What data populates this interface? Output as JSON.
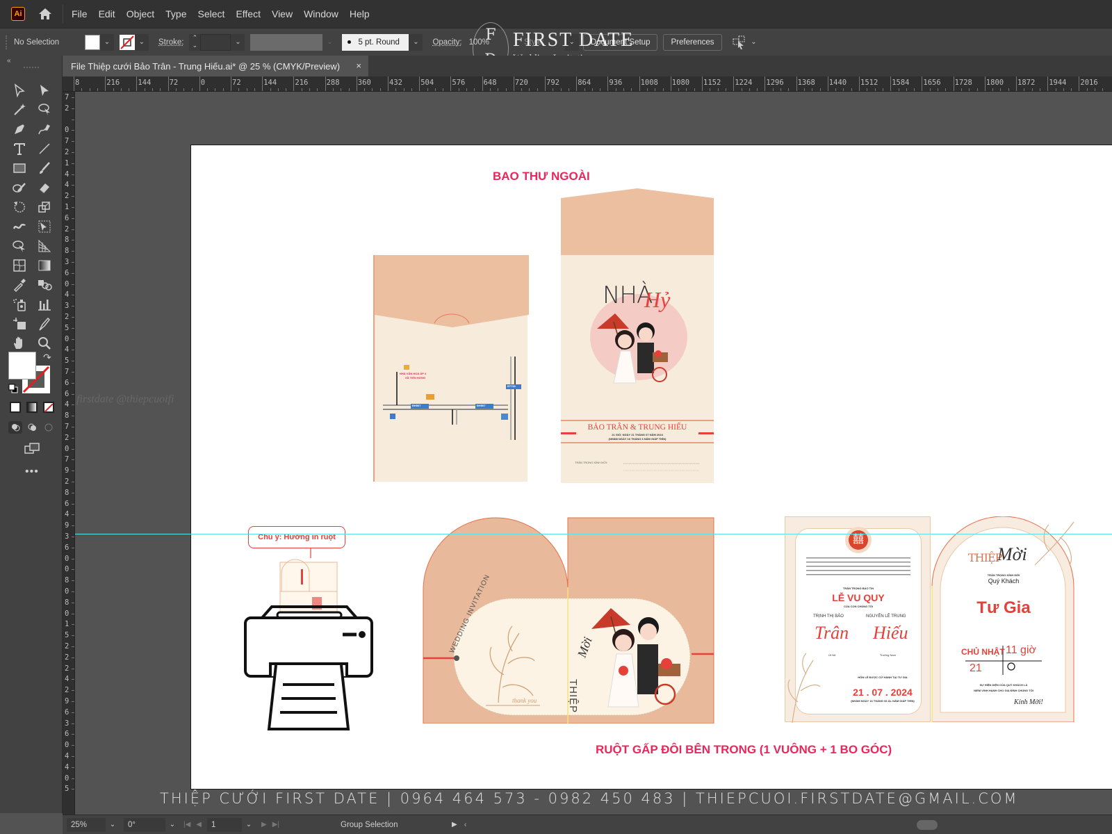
{
  "app": {
    "logo": "Ai",
    "menu": [
      "File",
      "Edit",
      "Object",
      "Type",
      "Select",
      "Effect",
      "View",
      "Window",
      "Help"
    ]
  },
  "control_bar": {
    "selection_state": "No Selection",
    "stroke_label": "Stroke:",
    "brush_label": "5 pt. Round",
    "opacity_label": "Opacity:",
    "opacity_value": "100%",
    "style_label": "Style:",
    "document_setup": "Document Setup",
    "preferences": "Preferences"
  },
  "brand": {
    "monogram_top": "F",
    "monogram_bottom": "D",
    "name": "FIRST DATE",
    "subtitle": "Wedding Invitation"
  },
  "document_tab": {
    "title": "File Thiệp cưới Bảo Trân - Trung Hiếu.ai* @ 25 % (CMYK/Preview)",
    "close": "×"
  },
  "rulers": {
    "horizontal": [
      "8",
      "216",
      "144",
      "72",
      "0",
      "72",
      "144",
      "216",
      "288",
      "360",
      "432",
      "504",
      "576",
      "648",
      "720",
      "792",
      "864",
      "936",
      "1008",
      "1080",
      "1152",
      "1224",
      "1296",
      "1368",
      "1440",
      "1512",
      "1584",
      "1656",
      "1728",
      "1800",
      "1872",
      "1944",
      "2016"
    ],
    "vertical": [
      "7",
      "2",
      "",
      "0",
      "7",
      "2",
      "1",
      "4",
      "4",
      "2",
      "1",
      "6",
      "2",
      "8",
      "8",
      "3",
      "6",
      "0",
      "4",
      "3",
      "2",
      "5",
      "0",
      "4",
      "5",
      "7",
      "6",
      "6",
      "4",
      "8",
      "7",
      "2",
      "0",
      "7",
      "9",
      "2",
      "8",
      "6",
      "4",
      "9",
      "3",
      "6",
      "0",
      "0",
      "8",
      "0",
      "8",
      "0",
      "1",
      "5",
      "2",
      "2",
      "2",
      "4",
      "2",
      "9",
      "6",
      "3",
      "6",
      "0",
      "4",
      "4",
      "0",
      "5"
    ]
  },
  "artboard": {
    "outer_envelope_title": "BAO THƯ NGOÀI",
    "inner_title": "RUỘT GẤP ĐÔI BÊN TRONG (1 VUÔNG + 1 BO GÓC)",
    "map": {
      "venue": "NHÀ VĂN HOÁ ẤP 4",
      "venue_sub": "XÃ TIẾN HƯNG",
      "road_labels": [
        "ĐH507",
        "ĐH507",
        "ĐT741"
      ]
    },
    "envelope_front": {
      "heading_left": "NHÀ",
      "heading_script": "Hỷ",
      "couple": "BẢO TRÂN & TRUNG HIẾU",
      "line1": "21 GIỜ, NGÀY 21 THÁNG 07 NĂM 2024",
      "line2": "(NHẰM NGÀY 16 THÁNG 6 NĂM GIÁP THÌN)",
      "invite_line": "TRÂN TRỌNG KÍNH MỜI:"
    },
    "printer_note": "Chú ý: Hướng in  ruột",
    "folded_cover": {
      "circle_text": "WEDDING INVITATION",
      "script": "thank you",
      "vertical": "THIỆP",
      "vertical_script": "Mời"
    },
    "inner_left": {
      "ceremony": "LỄ VU QUY",
      "intro": "TRÂN TRỌNG BÁO TIN",
      "children": "CỦA CON CHÚNG TÔI",
      "bride_name": "TRỊNH THỊ BẢO",
      "groom_name": "NGUYỄN LÊ TRUNG",
      "bride_script": "Trân",
      "groom_script": "Hiếu",
      "bride_role": "Út Nữ",
      "groom_role": "Trưởng Nam",
      "date_intro": "HÔN LỄ ĐƯỢC CỬ HÀNH TẠI TƯ GIA",
      "date": "21 . 07 . 2024",
      "lunar": "(NHẰM NGÀY 16 THÁNG 06 ÂL NĂM GIÁP THÌN)"
    },
    "inner_right": {
      "heading": "THIỆP",
      "heading_script": "Mời",
      "respect": "TRÂN TRỌNG KÍNH MỜI",
      "guest": "Quý Khách",
      "location_label": "Tư Gia",
      "day": "CHỦ NHẬT",
      "time": "11 giờ",
      "date_day": "21",
      "closing1": "SỰ HIỆN DIỆN CỦA QUÝ KHÁCH LÀ",
      "closing2": "NIỀM VINH HẠNH CHO GIA ĐÌNH CHÚNG TÔI",
      "sign": "Kính Mời!"
    }
  },
  "watermarks": {
    "footer": "THIỆP CƯỚI FIRST DATE | 0964 464 573 - 0982 450 483 | THIEPCUOI.FIRSTDATE@GMAIL.COM",
    "side": "firstdate    @thiepcuoifi"
  },
  "status_bar": {
    "zoom": "25%",
    "rotation": "0°",
    "artboard_number": "1",
    "tool": "Group Selection"
  },
  "colors": {
    "accent_pink": "#e8275b",
    "kraft": "#e8b99a",
    "guide": "#5fe0e8"
  }
}
